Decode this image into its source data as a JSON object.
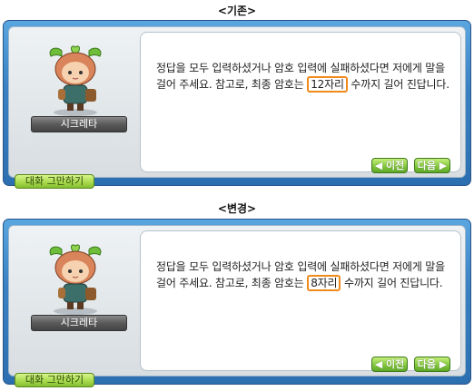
{
  "sections": [
    {
      "title": "<기존>",
      "npc_name": "시크레타",
      "text_before": "정답을 모두 입력하셨거나 암호 입력에 실패하셨다면 저에게 말을 걸어 주세요. 참고로, 최종 암호는 ",
      "highlight": "12자리",
      "text_after": " 수까지 길어 진답니다.",
      "prev_label": "◀ 이전",
      "next_label": "다음 ▶",
      "end_chat_label": "대화 그만하기"
    },
    {
      "title": "<변경>",
      "npc_name": "시크레타",
      "text_before": "정답을 모두 입력하셨거나 암호 입력에 실패하셨다면 저에게 말을 걸어 주세요. 참고로, 최종 암호는 ",
      "highlight": "8자리",
      "text_after": " 수까지 길어 진답니다.",
      "prev_label": "◀ 이전",
      "next_label": "다음 ▶",
      "end_chat_label": "대화 그만하기"
    }
  ],
  "colors": {
    "frame_blue": "#3a82c4",
    "highlight_orange": "#f08a1c",
    "button_green": "#7fc43a"
  },
  "icons": {
    "npc_portrait": "sprout-hair-girl-avatar"
  }
}
